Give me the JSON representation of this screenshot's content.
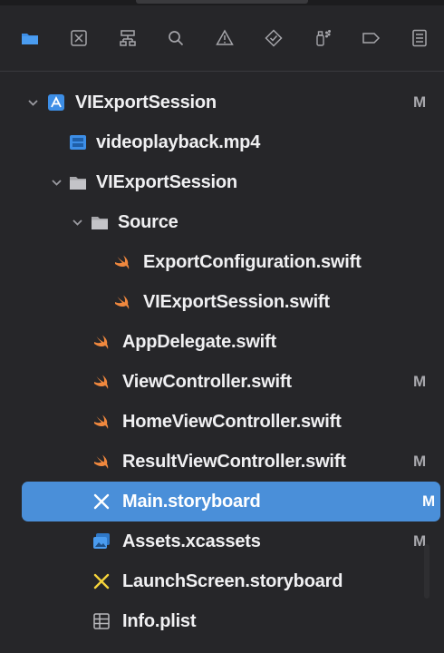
{
  "colors": {
    "background": "#262629",
    "selection": "#4a8fd9",
    "swift": "#f0883e",
    "folder": "#b9b9bd",
    "storyboard": "#f5d33b",
    "file_blue": "#3d8ee6"
  },
  "toolbar": {
    "items": [
      {
        "name": "project-navigator",
        "icon": "folder-icon",
        "active": true
      },
      {
        "name": "source-control-navigator",
        "icon": "source-control-icon"
      },
      {
        "name": "symbol-navigator",
        "icon": "hierarchy-icon"
      },
      {
        "name": "find-navigator",
        "icon": "search-icon"
      },
      {
        "name": "issue-navigator",
        "icon": "warning-icon"
      },
      {
        "name": "test-navigator",
        "icon": "test-diamond-icon"
      },
      {
        "name": "debug-navigator",
        "icon": "spray-icon"
      },
      {
        "name": "breakpoint-navigator",
        "icon": "breakpoint-icon"
      },
      {
        "name": "report-navigator",
        "icon": "report-icon"
      }
    ]
  },
  "tree": {
    "items": [
      {
        "label": "VIExportSession",
        "status": "M",
        "icon": "xcode-project-icon",
        "disclosure": "open"
      },
      {
        "label": "videoplayback.mp4",
        "status": "",
        "icon": "video-file-icon"
      },
      {
        "label": "VIExportSession",
        "status": "",
        "icon": "folder-icon",
        "disclosure": "open"
      },
      {
        "label": "Source",
        "status": "",
        "icon": "folder-icon",
        "disclosure": "open"
      },
      {
        "label": "ExportConfiguration.swift",
        "status": "",
        "icon": "swift-icon"
      },
      {
        "label": "VIExportSession.swift",
        "status": "",
        "icon": "swift-icon"
      },
      {
        "label": "AppDelegate.swift",
        "status": "",
        "icon": "swift-icon"
      },
      {
        "label": "ViewController.swift",
        "status": "M",
        "icon": "swift-icon"
      },
      {
        "label": "HomeViewController.swift",
        "status": "",
        "icon": "swift-icon"
      },
      {
        "label": "ResultViewController.swift",
        "status": "M",
        "icon": "swift-icon"
      },
      {
        "label": "Main.storyboard",
        "status": "M",
        "icon": "storyboard-icon",
        "selected": true
      },
      {
        "label": "Assets.xcassets",
        "status": "M",
        "icon": "assets-icon"
      },
      {
        "label": "LaunchScreen.storyboard",
        "status": "",
        "icon": "storyboard-icon"
      },
      {
        "label": "Info.plist",
        "status": "",
        "icon": "plist-icon"
      }
    ]
  }
}
